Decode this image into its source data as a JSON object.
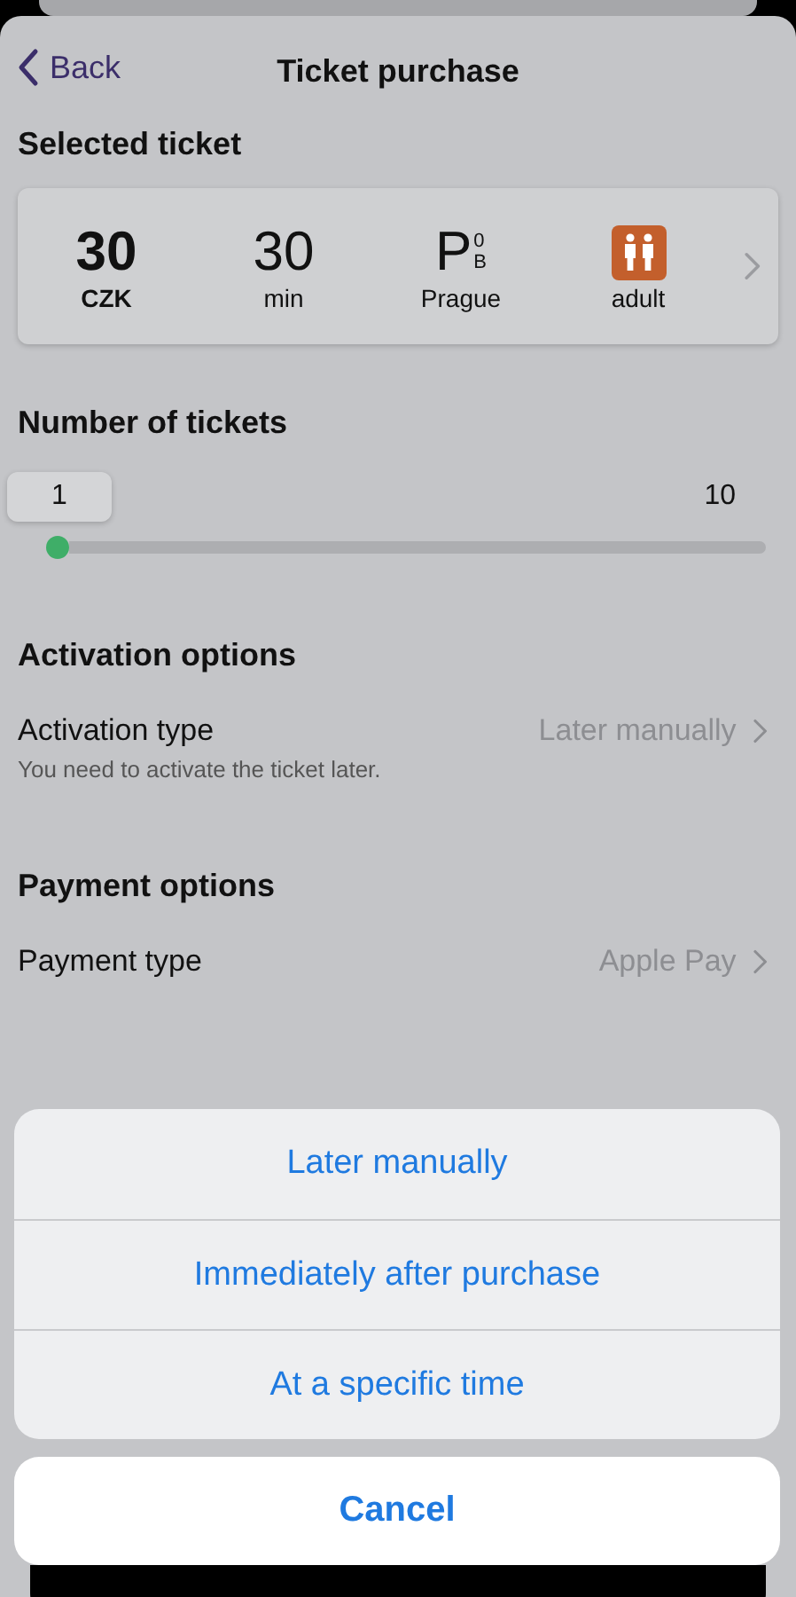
{
  "nav": {
    "back": "Back",
    "title": "Ticket purchase"
  },
  "selected_ticket": {
    "heading": "Selected ticket",
    "price": "30",
    "currency": "CZK",
    "duration": "30",
    "duration_unit": "min",
    "zone": "P",
    "zone_sup": "0",
    "zone_sub": "B",
    "zone_name": "Prague",
    "fare": "adult"
  },
  "tickets": {
    "heading": "Number of tickets",
    "value": "1",
    "max": "10",
    "level": 0
  },
  "activation": {
    "heading": "Activation options",
    "label": "Activation type",
    "value": "Later manually",
    "hint": "You need to activate the ticket later."
  },
  "payment": {
    "heading": "Payment options",
    "label": "Payment type",
    "value": "Apple Pay"
  },
  "action_sheet": {
    "options": [
      "Later manually",
      "Immediately after purchase",
      "At a specific time"
    ],
    "cancel": "Cancel"
  }
}
